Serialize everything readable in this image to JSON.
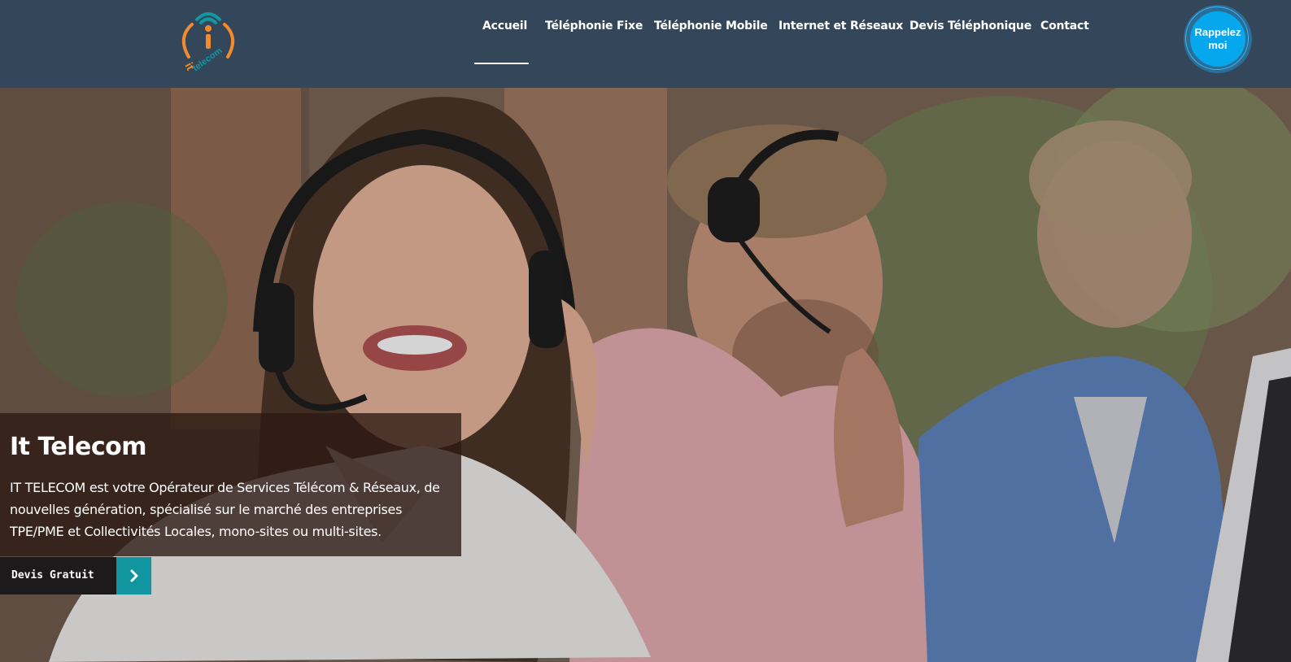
{
  "brand": {
    "logo_icon": "wifi-person-logo-icon",
    "logo_text": "it telecom",
    "colors": {
      "header_bg": "#34465a",
      "orange": "#f28a2e",
      "teal": "#1397a3"
    }
  },
  "nav": {
    "items": [
      {
        "label": "Accueil",
        "active": true
      },
      {
        "label": "Téléphonie Fixe"
      },
      {
        "label": "Téléphonie Mobile"
      },
      {
        "label": "Internet et Réseaux"
      },
      {
        "label": "Devis Téléphonique"
      },
      {
        "label": "Contact"
      }
    ]
  },
  "callback": {
    "line1": "Rappelez",
    "line2": "moi",
    "color": "#06a7ec"
  },
  "hero": {
    "title": "It Telecom",
    "text": "IT TELECOM est votre Opérateur de Services Télécom & Réseaux, de nouvelles génération, spécialisé sur le marché des entreprises TPE/PME et Collectivités Locales, mono-sites ou multi-sites.",
    "cta_label": "Devis Gratuit",
    "cta_icon": "chevron-right-icon",
    "cta_color": "#11969f"
  }
}
